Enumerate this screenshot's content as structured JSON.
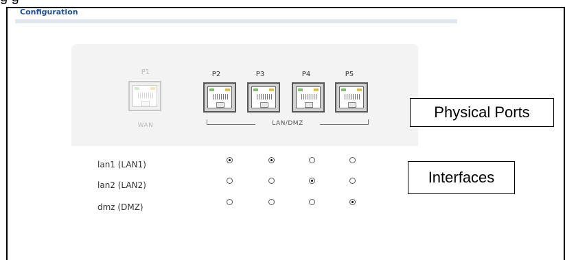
{
  "config_title": "Configuration",
  "ports": [
    {
      "id": "P1",
      "enabled": false
    },
    {
      "id": "P2",
      "enabled": true
    },
    {
      "id": "P3",
      "enabled": true
    },
    {
      "id": "P4",
      "enabled": true
    },
    {
      "id": "P5",
      "enabled": true
    }
  ],
  "wan_label": "WAN",
  "lan_group_label": "LAN/DMZ",
  "interfaces": [
    {
      "label": "lan1 (LAN1)",
      "selected": [
        true,
        true,
        false,
        false
      ]
    },
    {
      "label": "lan2 (LAN2)",
      "selected": [
        false,
        false,
        true,
        false
      ]
    },
    {
      "label": "dmz (DMZ)",
      "selected": [
        false,
        false,
        false,
        true
      ]
    }
  ],
  "callouts": {
    "physical_ports": "Physical Ports",
    "interfaces": "Interfaces"
  },
  "colors": {
    "title": "#1f4f99",
    "title_rule": "#e1e6ef",
    "panel": "#f3f3f3",
    "link_led": "#7ec36b",
    "activity_led": "#e8c040"
  }
}
